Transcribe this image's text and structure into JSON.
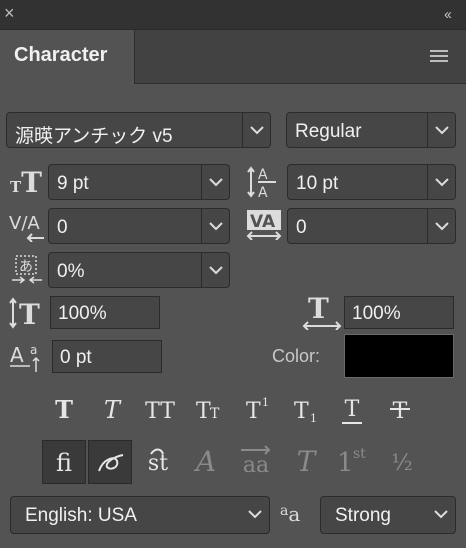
{
  "panel": {
    "title": "Character",
    "close_icon": "close-icon",
    "collapse_icon": "double-chevron-icon",
    "menu_icon": "panel-menu-icon"
  },
  "font": {
    "family": "源暎アンチック v5",
    "style": "Regular"
  },
  "size": {
    "font_size": "9 pt",
    "leading": "10 pt"
  },
  "spacing": {
    "kerning": "0",
    "tracking": "0",
    "tsume": "0%"
  },
  "scale": {
    "vertical": "100%",
    "horizontal": "100%"
  },
  "baseline": {
    "shift": "0 pt"
  },
  "color": {
    "label": "Color:",
    "value": "#000000"
  },
  "style_buttons": [
    {
      "glyph": "T",
      "name": "faux-bold-button"
    },
    {
      "glyph": "T",
      "name": "faux-italic-button"
    },
    {
      "glyph": "TT",
      "name": "all-caps-button"
    },
    {
      "glyph": "TT",
      "name": "small-caps-button"
    },
    {
      "glyph": "T1",
      "name": "superscript-button"
    },
    {
      "glyph": "T1",
      "name": "subscript-button"
    },
    {
      "glyph": "T",
      "name": "underline-button"
    },
    {
      "glyph": "T",
      "name": "strikethrough-button"
    }
  ],
  "opentype_buttons": [
    {
      "glyph": "fi",
      "name": "ligatures-button",
      "state": "on"
    },
    {
      "glyph": "o",
      "name": "contextual-alternates-button",
      "state": "on"
    },
    {
      "glyph": "st",
      "name": "discretionary-ligatures-button",
      "state": "lit"
    },
    {
      "glyph": "A",
      "name": "swash-button",
      "state": "dim"
    },
    {
      "glyph": "aa",
      "name": "stylistic-alternates-button",
      "state": "dim"
    },
    {
      "glyph": "T",
      "name": "titling-alternates-button",
      "state": "dim"
    },
    {
      "glyph": "1st",
      "name": "ordinals-button",
      "state": "dim"
    },
    {
      "glyph": "1/2",
      "name": "fractions-button",
      "state": "dim"
    }
  ],
  "language": {
    "value": "English: USA"
  },
  "antialias": {
    "icon_text": "aa",
    "value": "Strong"
  }
}
